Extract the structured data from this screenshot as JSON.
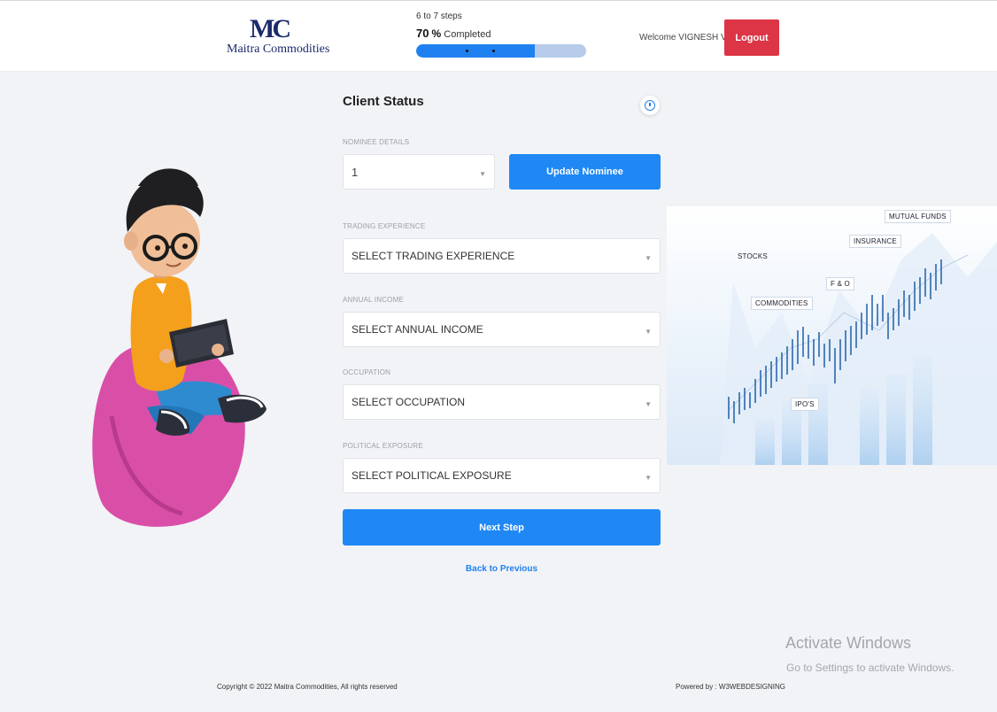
{
  "header": {
    "logo_mark": "MC",
    "logo_text": "Maitra Commodities",
    "steps_text": "6 to 7 steps",
    "progress_percent": "70",
    "progress_symbol": "%",
    "progress_label": "Completed",
    "progress_fraction": 0.7,
    "welcome_text": "Welcome VIGNESH V",
    "logout_label": "Logout"
  },
  "form": {
    "title": "Client Status",
    "nominee": {
      "label": "NOMINEE DETAILS",
      "value": "1",
      "update_label": "Update Nominee"
    },
    "fields": [
      {
        "label": "TRADING EXPERIENCE",
        "value": "SELECT TRADING EXPERIENCE"
      },
      {
        "label": "ANNUAL INCOME",
        "value": "SELECT ANNUAL INCOME"
      },
      {
        "label": "OCCUPATION",
        "value": "SELECT OCCUPATION"
      },
      {
        "label": "POLITICAL EXPOSURE",
        "value": "SELECT POLITICAL EXPOSURE"
      }
    ],
    "next_label": "Next Step",
    "back_label": "Back to Previous"
  },
  "chart_image": {
    "labels": [
      "MUTUAL FUNDS",
      "INSURANCE",
      "STOCKS",
      "F & O",
      "COMMODITIES",
      "IPO'S"
    ]
  },
  "footer": {
    "copyright": "Copyright © 2022 Maitra Commodities, All rights reserved",
    "powered": "Powered by : W3WEBDESIGNING"
  },
  "watermark": {
    "title": "Activate Windows",
    "subtitle": "Go to Settings to activate Windows."
  },
  "colors": {
    "primary": "#1f88f5",
    "danger": "#dc3545",
    "brand": "#1b2a6b"
  }
}
